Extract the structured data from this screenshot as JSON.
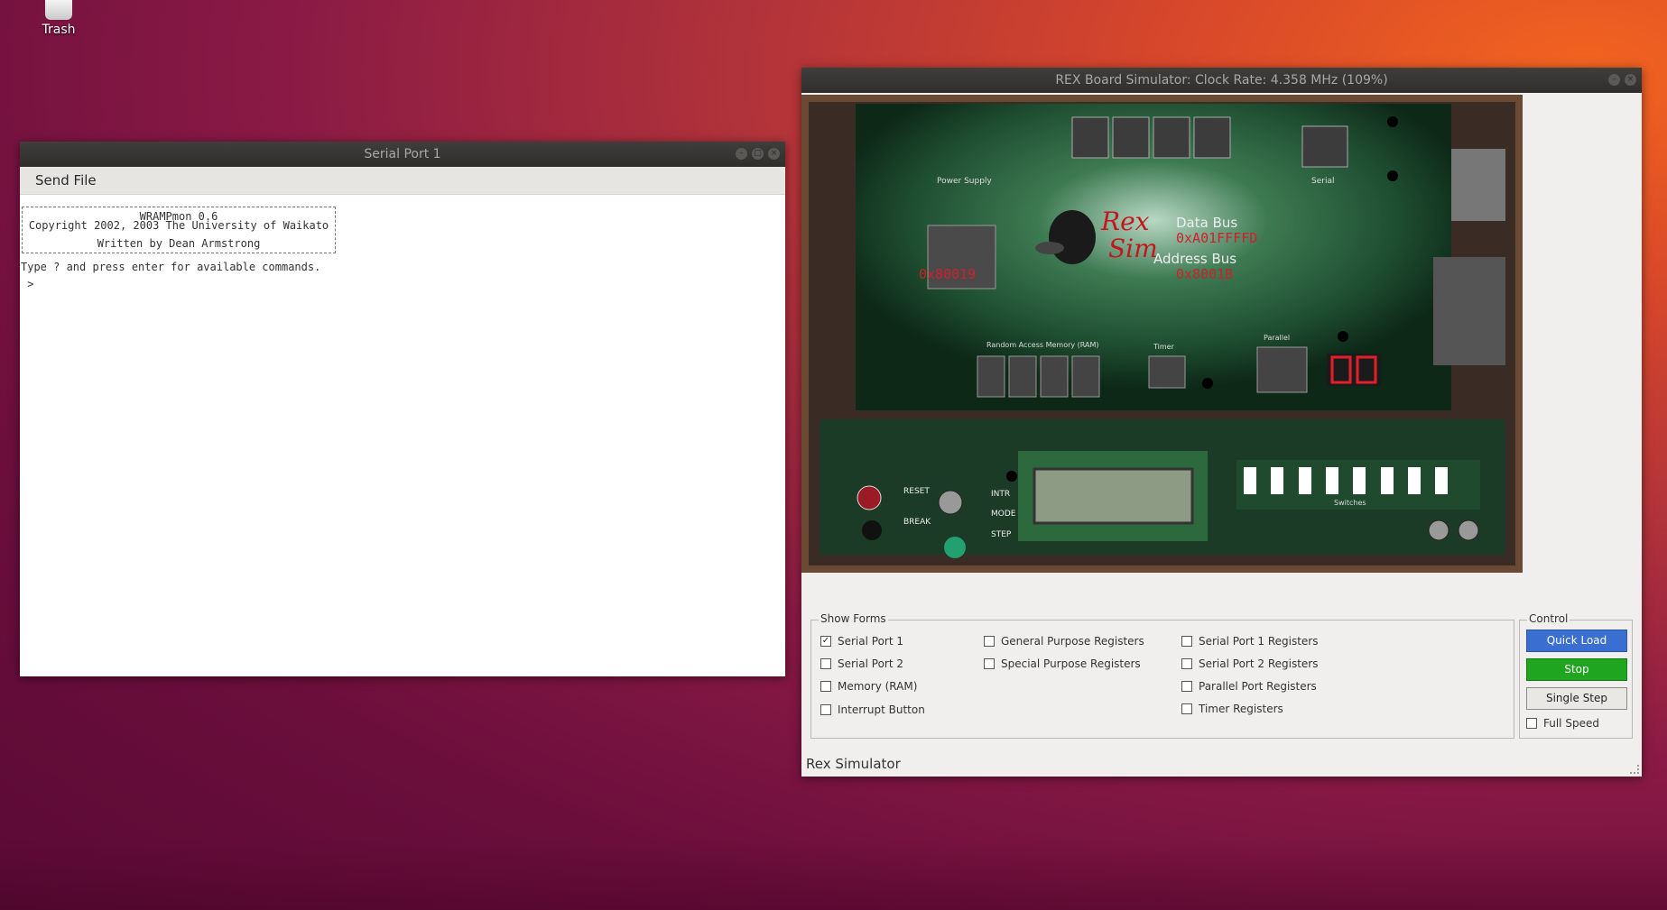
{
  "desktop": {
    "trash_label": "Trash"
  },
  "serial_window": {
    "title": "Serial Port 1",
    "menu": [
      "Send File"
    ],
    "banner": [
      "WRAMPmon 0.6",
      "Copyright 2002, 2003 The University of Waikato",
      "Written by Dean Armstrong"
    ],
    "lines": [
      "Type ? and press enter for available commands.",
      " >"
    ]
  },
  "rex_window": {
    "title": "REX Board Simulator: Clock Rate: 4.358 MHz (109%)",
    "board": {
      "logo_line1": "Rex",
      "logo_line2": "Sim",
      "data_bus_label": "Data Bus",
      "data_bus_value": "0xA01FFFFD",
      "address_bus_label": "Address Bus",
      "address_bus_value": "0x8001B",
      "left_value": "0x80019",
      "seven_seg": [
        "0",
        "0"
      ],
      "silkscreen": {
        "power": "Power Supply",
        "serial": "Serial",
        "ram": "Random Access Memory (RAM)",
        "parallel": "Parallel",
        "timer": "Timer",
        "reset": "RESET",
        "break": "BREAK",
        "intr": "INTR",
        "mode": "MODE",
        "step": "STEP",
        "switches": "Switches"
      }
    },
    "show_forms": {
      "title": "Show Forms",
      "items": [
        {
          "label": "Serial Port 1",
          "checked": true
        },
        {
          "label": "Serial Port 2",
          "checked": false
        },
        {
          "label": "Memory (RAM)",
          "checked": false
        },
        {
          "label": "Interrupt Button",
          "checked": false
        },
        {
          "label": "General Purpose Registers",
          "checked": false
        },
        {
          "label": "Special Purpose Registers",
          "checked": false
        },
        {
          "label": "Serial Port 1 Registers",
          "checked": false
        },
        {
          "label": "Serial Port 2 Registers",
          "checked": false
        },
        {
          "label": "Parallel Port Registers",
          "checked": false
        },
        {
          "label": "Timer Registers",
          "checked": false
        }
      ]
    },
    "control": {
      "title": "Control",
      "quick_load": "Quick Load",
      "stop": "Stop",
      "single_step": "Single Step",
      "full_speed": {
        "label": "Full Speed",
        "checked": false
      },
      "colors": {
        "quick_load": "#3a6fd1",
        "stop": "#1fa51f"
      }
    },
    "status": "Rex Simulator"
  }
}
